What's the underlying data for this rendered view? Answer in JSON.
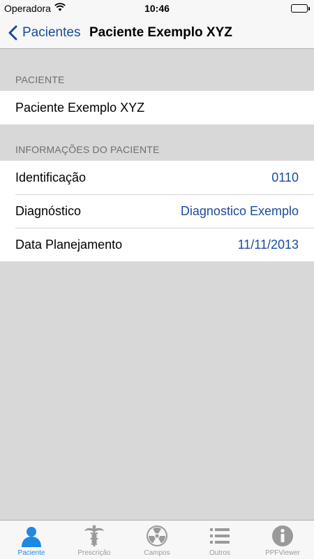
{
  "status_bar": {
    "carrier": "Operadora",
    "time": "10:46"
  },
  "nav": {
    "back_label": "Pacientes",
    "title": "Paciente Exemplo XYZ"
  },
  "sections": {
    "patient_header": "PACIENTE",
    "patient_name": "Paciente Exemplo XYZ",
    "info_header": "INFORMAÇÕES DO PACIENTE",
    "info_rows": [
      {
        "label": "Identificação",
        "value": "0110"
      },
      {
        "label": "Diagnóstico",
        "value": "Diagnostico Exemplo"
      },
      {
        "label": "Data Planejamento",
        "value": "11/11/2013"
      }
    ]
  },
  "tab_bar": {
    "tabs": [
      {
        "label": "Paciente",
        "icon": "person-icon",
        "active": true
      },
      {
        "label": "Prescrição",
        "icon": "caduceus-icon",
        "active": false
      },
      {
        "label": "Campos",
        "icon": "radiation-icon",
        "active": false
      },
      {
        "label": "Outros",
        "icon": "list-icon",
        "active": false
      },
      {
        "label": "PPFViewer",
        "icon": "info-icon",
        "active": false
      }
    ]
  },
  "colors": {
    "accent": "#1a4a9c",
    "tab_active": "#1e88e5",
    "tab_inactive": "#9a9a9a",
    "background": "#d8d8d8"
  }
}
